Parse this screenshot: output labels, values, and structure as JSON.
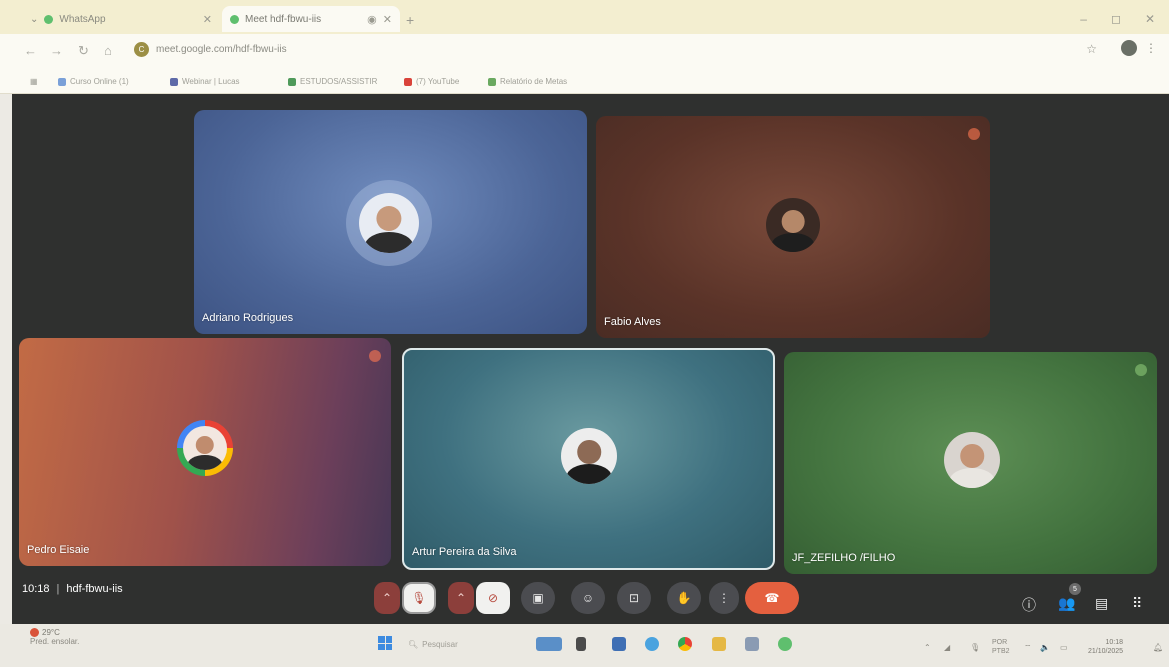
{
  "browser": {
    "tabs": [
      {
        "title": "WhatsApp",
        "active": false
      },
      {
        "title": "Meet hdf-fbwu-iis",
        "active": true
      }
    ],
    "new_tab_label": "+",
    "window_controls": [
      "–",
      "◻",
      "✕"
    ],
    "address": "meet.google.com/hdf-fbwu-iis",
    "site_badge": "C",
    "bookmarks": [
      "Curso Online (1)",
      "Webinar | Lucas",
      "ESTUDOS/ASSISTIR",
      "(7) YouTube",
      "Relatório de Metas"
    ]
  },
  "meeting": {
    "time": "10:18",
    "code": "hdf-fbwu-iis",
    "people_count": "5",
    "participants": [
      {
        "name": "Adriano Rodrigues"
      },
      {
        "name": "Fabio Alves"
      },
      {
        "name": "Pedro Eisaie"
      },
      {
        "name": "Artur Pereira da Silva"
      },
      {
        "name": "JF_ZEFILHO /FILHO"
      }
    ]
  },
  "taskbar": {
    "weather_temp": "29°C",
    "weather_desc": "Pred. ensolar.",
    "search_placeholder": "Pesquisar",
    "lang": "POR",
    "lang2": "PTB2",
    "clock_time": "10:18",
    "clock_date": "21/10/2025"
  },
  "colors": {
    "hangup": "#e4603f",
    "stage": "#2f302f",
    "tab_bar": "#f3eed0"
  }
}
